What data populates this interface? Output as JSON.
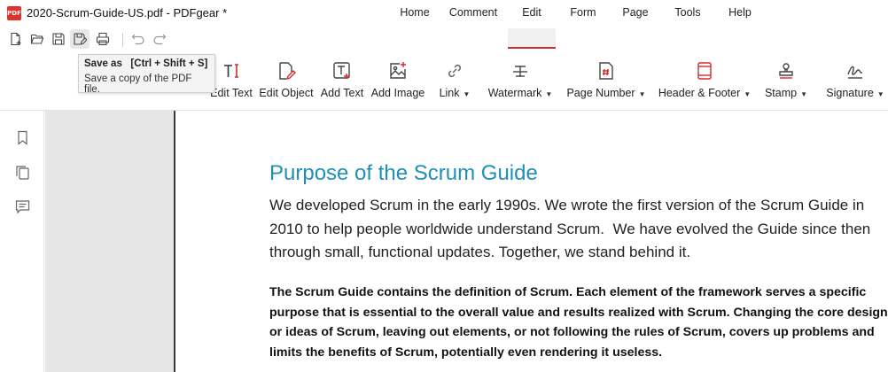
{
  "window": {
    "logo_text": "PDF",
    "title": "2020-Scrum-Guide-US.pdf - PDFgear *"
  },
  "quick_access": [
    {
      "icon": "new-file-icon"
    },
    {
      "icon": "open-folder-icon"
    },
    {
      "icon": "save-icon"
    },
    {
      "icon": "save-as-icon"
    },
    {
      "icon": "print-icon"
    },
    {
      "icon": "undo-icon"
    },
    {
      "icon": "redo-icon"
    }
  ],
  "menu": {
    "items": [
      "Home",
      "Comment",
      "Edit",
      "Form",
      "Page",
      "Tools",
      "Help"
    ],
    "active": "Edit",
    "accent_color": "#d42b2b"
  },
  "tooltip": {
    "title": "Save as   [Ctrl + Shift + S]",
    "description": "Save a copy of the PDF file."
  },
  "ribbon": {
    "tools": [
      {
        "label": "Edit Text",
        "icon": "edit-text-icon",
        "dropdown": false
      },
      {
        "label": "Edit Object",
        "icon": "edit-object-icon",
        "dropdown": false
      },
      {
        "label": "Add Text",
        "icon": "add-text-icon",
        "dropdown": false
      },
      {
        "label": "Add Image",
        "icon": "add-image-icon",
        "dropdown": false
      },
      {
        "label": "Link",
        "icon": "link-icon",
        "dropdown": true
      },
      {
        "label": "Watermark",
        "icon": "watermark-icon",
        "dropdown": true
      },
      {
        "label": "Page Number",
        "icon": "page-number-icon",
        "dropdown": true
      },
      {
        "label": "Header & Footer",
        "icon": "header-footer-icon",
        "dropdown": true
      },
      {
        "label": "Stamp",
        "icon": "stamp-icon",
        "dropdown": true
      },
      {
        "label": "Signature",
        "icon": "signature-icon",
        "dropdown": true
      }
    ]
  },
  "sidebar": [
    {
      "icon": "bookmark-icon"
    },
    {
      "icon": "thumbnails-icon"
    },
    {
      "icon": "comments-icon"
    }
  ],
  "document": {
    "heading": "Purpose of the Scrum Guide",
    "heading_color": "#1f8fb8",
    "paragraph_lines": [
      "We developed Scrum in the early 1990s. We wrote the first version of the Scrum Guide in",
      "2010 to help people worldwide understand Scrum.  We have evolved the Guide since then",
      "through small, functional updates. Together, we stand behind it."
    ],
    "bold_lines": [
      "The Scrum Guide contains the definition of Scrum. Each element of the framework serves a specific",
      "purpose that is essential to the overall value and results realized with Scrum. Changing the core design",
      "or ideas of Scrum, leaving out elements, or not following the rules of Scrum, covers up problems and",
      "limits the benefits of Scrum, potentially even rendering it useless."
    ]
  }
}
